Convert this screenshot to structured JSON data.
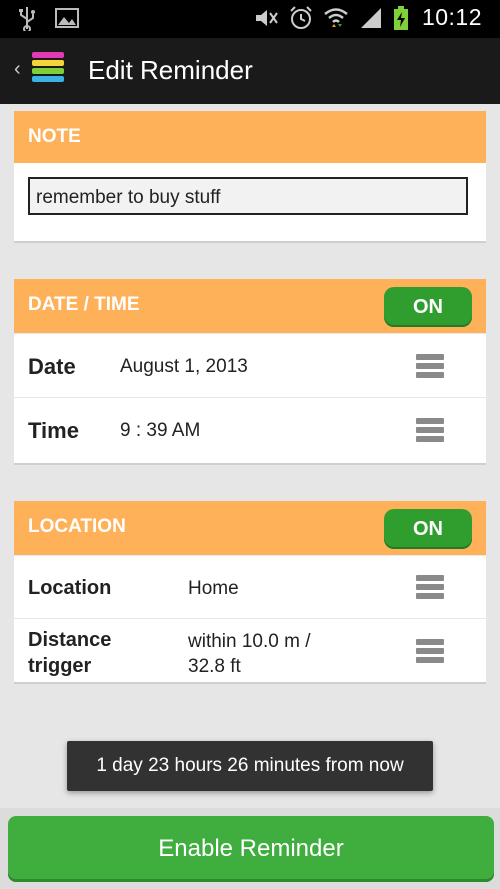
{
  "status_bar": {
    "time": "10:12",
    "icons": [
      "usb-icon",
      "image-icon",
      "mute-icon",
      "alarm-icon",
      "wifi-icon",
      "signal-icon",
      "battery-charging-icon"
    ]
  },
  "action_bar": {
    "title": "Edit Reminder",
    "back_glyph": "‹"
  },
  "note": {
    "header": "NOTE",
    "value": "remember to buy stuff"
  },
  "datetime": {
    "header": "DATE / TIME",
    "toggle": "ON",
    "rows": [
      {
        "label": "Date",
        "value": "August 1, 2013"
      },
      {
        "label": "Time",
        "value": "9 : 39 AM"
      }
    ]
  },
  "location": {
    "header": "LOCATION",
    "toggle": "ON",
    "rows": [
      {
        "label": "Location",
        "value": "Home"
      },
      {
        "label_line1": "Distance",
        "label_line2": "trigger",
        "value_line1": "within 10.0 m /",
        "value_line2": "32.8 ft"
      }
    ]
  },
  "toast": "1 day 23 hours 26 minutes from now",
  "enable_button": "Enable Reminder",
  "colors": {
    "header_orange": "#ffb15a",
    "toggle_green": "#2f9e2f",
    "button_green": "#3fae3f"
  }
}
